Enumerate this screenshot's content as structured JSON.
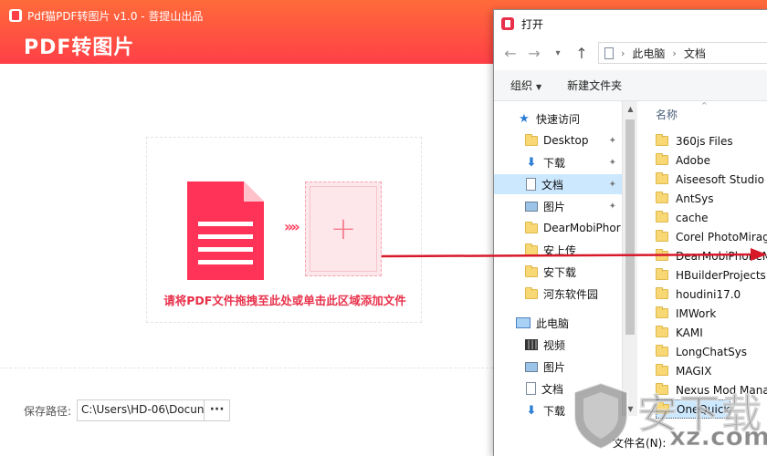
{
  "app": {
    "window_title": "Pdf猫PDF转图片 v1.0 - 菩提山出品",
    "heading": "PDF转图片",
    "drop_hint": "请将PDF文件拖拽至此处或单击此区域添加文件",
    "add_symbol": "+",
    "chevrons": "»»",
    "save_label": "保存路径:",
    "save_path": "C:\\Users\\HD-06\\Docun",
    "save_more": "···",
    "accent_color": "#ff3f47"
  },
  "dialog": {
    "title": "打开",
    "breadcrumb": [
      "此电脑",
      "文档"
    ],
    "toolbar": {
      "organize": "组织",
      "new_folder": "新建文件夹"
    },
    "nav_items": [
      {
        "label": "快速访问",
        "icon": "star-icon",
        "pinned": false,
        "selected": false
      },
      {
        "label": "Desktop",
        "icon": "folder-icon",
        "pinned": true,
        "selected": false
      },
      {
        "label": "下载",
        "icon": "download-icon",
        "pinned": true,
        "selected": false
      },
      {
        "label": "文档",
        "icon": "document-icon",
        "pinned": true,
        "selected": true
      },
      {
        "label": "图片",
        "icon": "picture-icon",
        "pinned": true,
        "selected": false
      },
      {
        "label": "DearMobiPhor",
        "icon": "folder-icon",
        "pinned": false,
        "selected": false
      },
      {
        "label": "安上传",
        "icon": "folder-icon",
        "pinned": false,
        "selected": false
      },
      {
        "label": "安下载",
        "icon": "folder-icon",
        "pinned": false,
        "selected": false
      },
      {
        "label": "河东软件园",
        "icon": "folder-icon",
        "pinned": false,
        "selected": false
      },
      {
        "label": "此电脑",
        "icon": "computer-icon",
        "pinned": false,
        "selected": false
      },
      {
        "label": "视频",
        "icon": "video-icon",
        "pinned": false,
        "selected": false
      },
      {
        "label": "图片",
        "icon": "picture-icon",
        "pinned": false,
        "selected": false
      },
      {
        "label": "文档",
        "icon": "document-icon",
        "pinned": false,
        "selected": false
      },
      {
        "label": "下载",
        "icon": "download-icon",
        "pinned": false,
        "selected": false
      }
    ],
    "column_header": "名称",
    "files": [
      "360js Files",
      "Adobe",
      "Aiseesoft Studio",
      "AntSys",
      "cache",
      "Corel PhotoMirage",
      "DearMobiPhoneManager",
      "HBuilderProjects",
      "houdini17.0",
      "IMWork",
      "KAMI",
      "LongChatSys",
      "MAGIX",
      "Nexus Mod Manager",
      "OneQuick"
    ],
    "filename_label": "文件名(N):"
  },
  "watermark": {
    "main": "安下载",
    "sub": "xz.com"
  }
}
